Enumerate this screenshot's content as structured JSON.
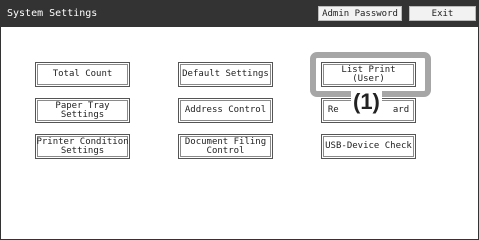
{
  "window": {
    "title": "System Settings",
    "buttons": {
      "admin_password": "Admin Password",
      "exit": "Exit"
    }
  },
  "menu": {
    "total_count": "Total Count",
    "default_settings": "Default Settings",
    "list_print_user": "List Print\n(User)",
    "paper_tray_settings": "Paper Tray\nSettings",
    "address_control": "Address Control",
    "register_keyboard": "Re          ard",
    "printer_condition_settings": "Printer Condition\nSettings",
    "document_filing_control": "Document Filing\nControl",
    "usb_device_check": "USB-Device Check"
  },
  "annotation": {
    "callout": "(1)"
  }
}
